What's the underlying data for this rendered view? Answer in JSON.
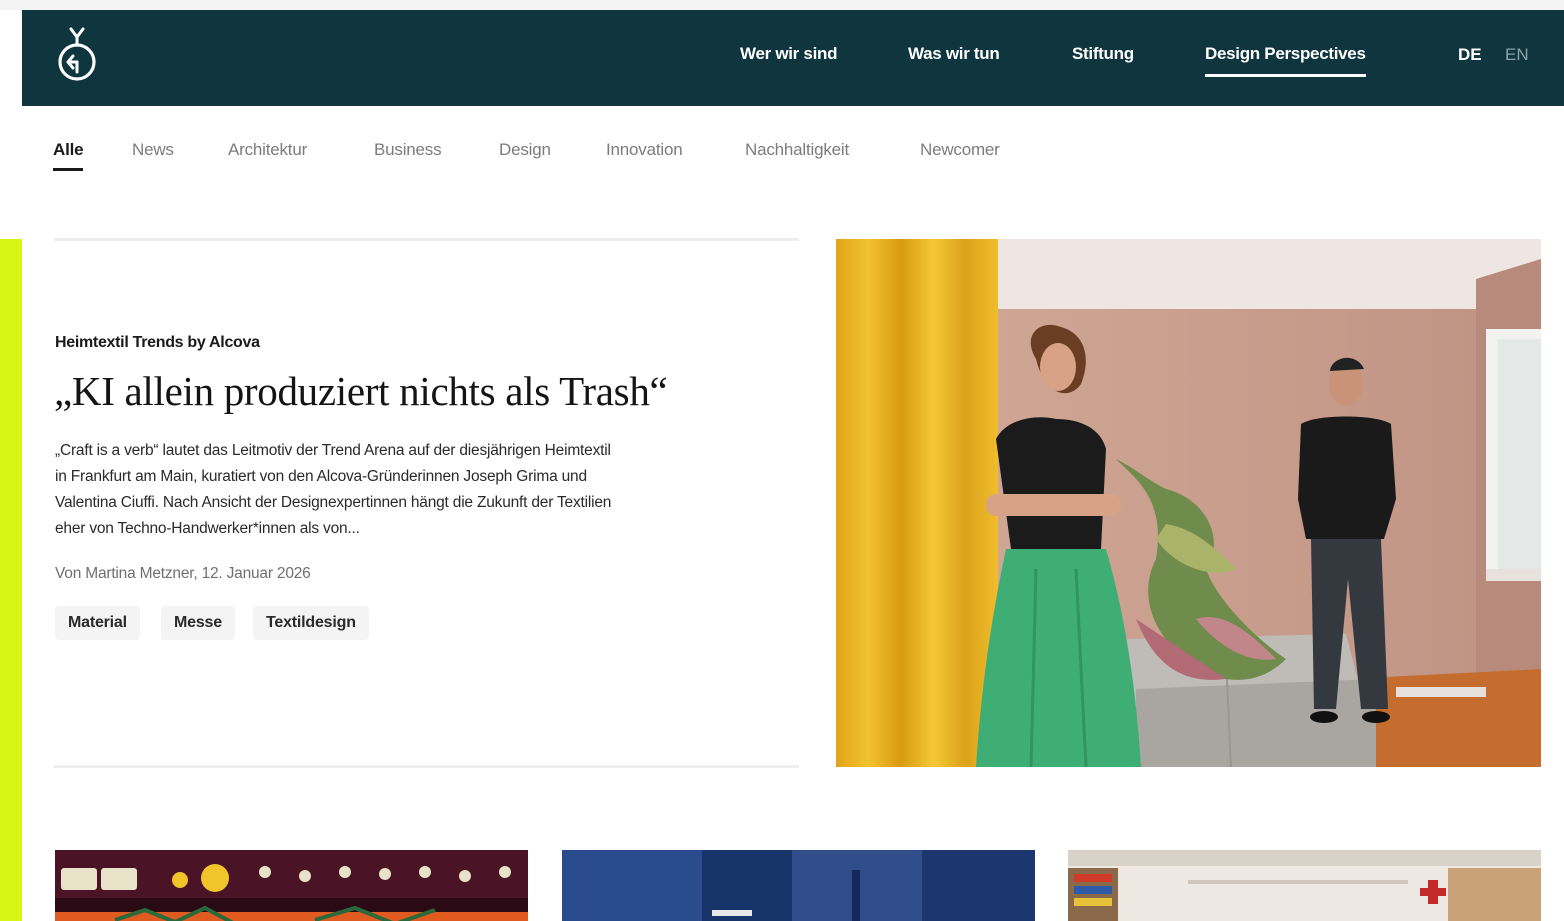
{
  "header": {
    "logo_label": "",
    "nav": [
      {
        "label": "Wer wir sind"
      },
      {
        "label": "Was wir tun"
      },
      {
        "label": "Stiftung"
      },
      {
        "label": "Design Perspectives",
        "active": true
      }
    ],
    "languages": [
      {
        "label": "DE",
        "active": true
      },
      {
        "label": "EN"
      }
    ]
  },
  "categories": [
    {
      "label": "Alle",
      "active": true
    },
    {
      "label": "News"
    },
    {
      "label": "Architektur"
    },
    {
      "label": "Business"
    },
    {
      "label": "Design"
    },
    {
      "label": "Innovation"
    },
    {
      "label": "Nachhaltigkeit"
    },
    {
      "label": "Newcomer"
    }
  ],
  "featured": {
    "kicker": "Heimtextil Trends by Alcova",
    "headline": "„KI allein produziert nichts als Trash“",
    "teaser_lines": [
      "„Craft is a verb“ lautet das Leitmotiv der Trend Arena auf der diesjährigen Heimtextil",
      "in Frankfurt am Main, kuratiert von den Alcova-Gründerinnen Joseph Grima und",
      "Valentina Ciuffi. Nach Ansicht der Designexpertinnen hängt die Zukunft der Textilien",
      "eher von Techno-Handwerker*innen als von..."
    ],
    "byline": "Von Martina Metzner, 12. Januar 2026",
    "tags": [
      {
        "label": "Material"
      },
      {
        "label": "Messe"
      },
      {
        "label": "Textildesign"
      }
    ]
  },
  "colors": {
    "header_bg": "#0f353e",
    "accent_lime": "#d9f516",
    "text_dark": "#1a1a1a",
    "text_muted": "#7c7c7c"
  }
}
